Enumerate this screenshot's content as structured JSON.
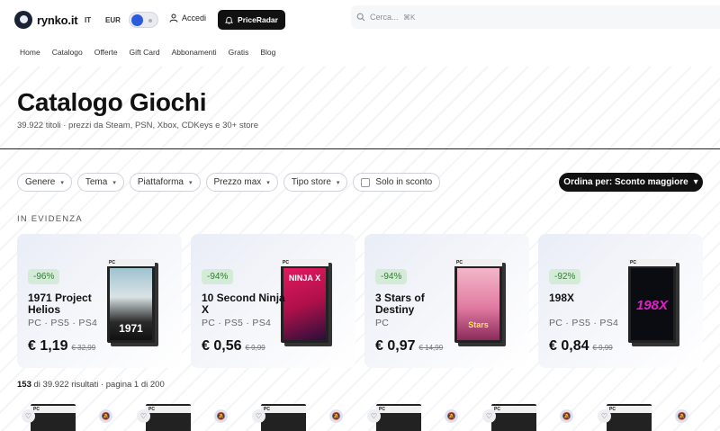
{
  "header": {
    "logo_text": "rynko.it",
    "lang": "IT",
    "currency": "EUR",
    "login_label": "Accedi",
    "priceradar_label": "PriceRadar",
    "search_placeholder": "Cerca...",
    "search_shortcut": "⌘K"
  },
  "nav": [
    "Home",
    "Catalogo",
    "Offerte",
    "Gift Card",
    "Abbonamenti",
    "Gratis",
    "Blog"
  ],
  "hero": {
    "title": "Catalogo Giochi",
    "subtitle": "39.922 titoli · prezzi da Steam, PSN, Xbox, CDKeys e 30+ store"
  },
  "filters": [
    "Genere",
    "Tema",
    "Piattaforma",
    "Prezzo max",
    "Tipo store"
  ],
  "checkbox_label": "Solo in sconto",
  "sort_label": "Ordina per: Sconto maggiore",
  "featured_title": "IN EVIDENZA",
  "featured": [
    {
      "discount": "-96%",
      "name": "1971 Project Helios",
      "platforms": "PC · PS5 · PS4",
      "price": "€ 1,19",
      "old_price": "€ 32,99",
      "cover_text": "1971"
    },
    {
      "discount": "-94%",
      "name": "10 Second Ninja X",
      "platforms": "PC · PS5 · PS4",
      "price": "€ 0,56",
      "old_price": "€ 9,99",
      "cover_text": "NINJA X"
    },
    {
      "discount": "-94%",
      "name": "3 Stars of Destiny",
      "platforms": "PC",
      "price": "€ 0,97",
      "old_price": "€ 14,99",
      "cover_text": "Stars"
    },
    {
      "discount": "-92%",
      "name": "198X",
      "platforms": "PC · PS5 · PS4",
      "price": "€ 0,84",
      "old_price": "€ 9,99",
      "cover_text": "198X"
    }
  ],
  "results": {
    "count": "153",
    "text": " di 39.922 risultati · pagina 1 di 200"
  },
  "box_label": "PC",
  "icons": [
    "search-icon",
    "user-icon",
    "bell-icon",
    "chevron-down-icon",
    "heart-icon",
    "bell-off-icon"
  ]
}
